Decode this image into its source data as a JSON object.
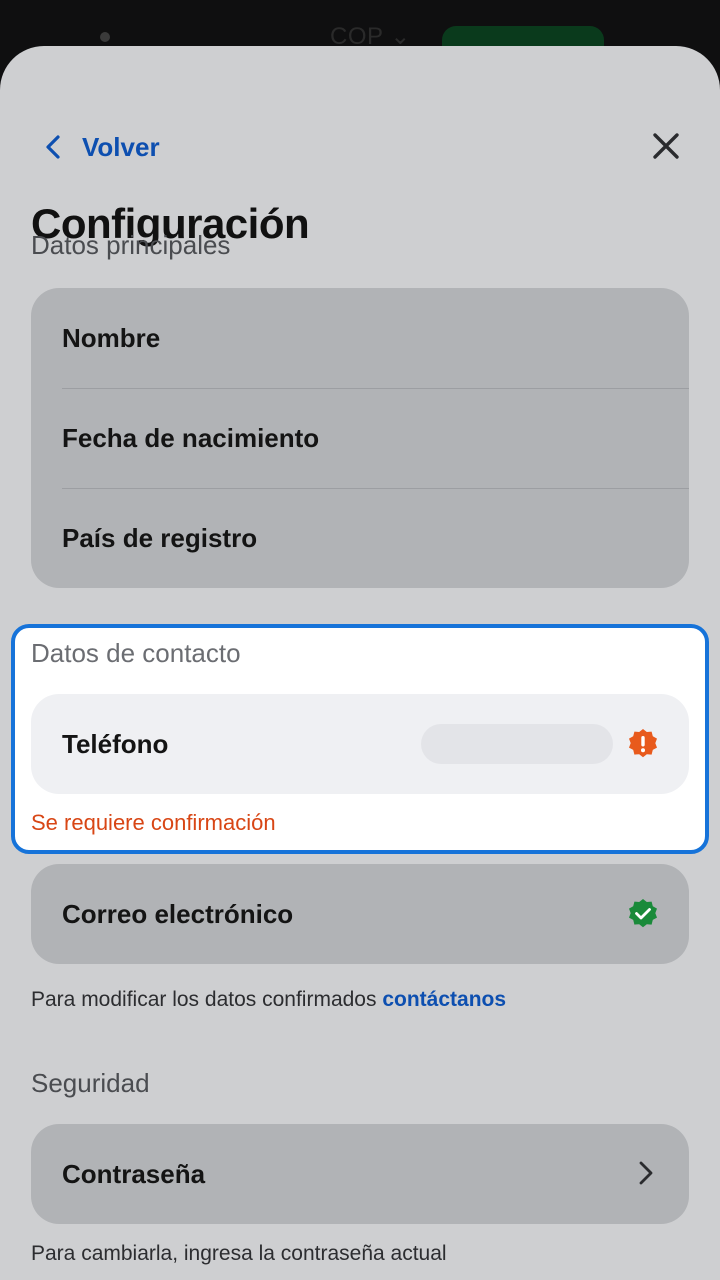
{
  "background": {
    "currency": "COP"
  },
  "header": {
    "back_label": "Volver",
    "title": "Configuración"
  },
  "main_data": {
    "section_label": "Datos principales",
    "items": [
      {
        "label": "Nombre"
      },
      {
        "label": "Fecha de nacimiento"
      },
      {
        "label": "País de registro"
      }
    ]
  },
  "contact": {
    "section_label": "Datos de contacto",
    "phone": {
      "label": "Teléfono",
      "status_icon": "warning-badge-icon",
      "error": "Se requiere confirmación"
    },
    "email": {
      "label": "Correo electrónico",
      "status_icon": "verified-check-icon"
    },
    "helper_text": "Para modificar los datos confirmados",
    "helper_link": "contáctanos"
  },
  "security": {
    "section_label": "Seguridad",
    "password": {
      "label": "Contraseña"
    },
    "helper_text": "Para cambiarla, ingresa la contraseña actual"
  },
  "colors": {
    "accent": "#0d4fb0",
    "highlight_border": "#1673d9",
    "warning": "#e85a1c",
    "success": "#1a8a3a",
    "error_text": "#d84615"
  }
}
